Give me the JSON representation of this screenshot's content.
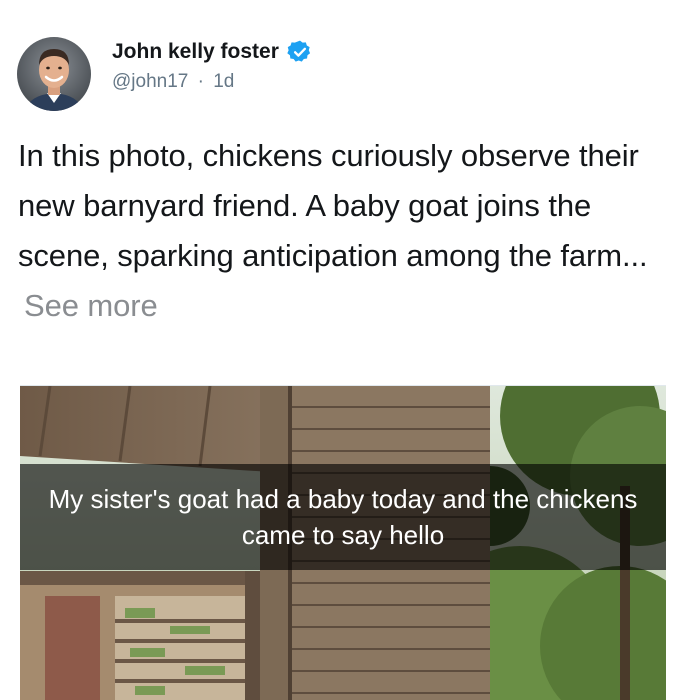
{
  "tweet": {
    "author": {
      "name": "John kelly foster",
      "handle": "@john17",
      "separator": "·",
      "time": "1d",
      "verified": true
    },
    "text": "In this photo, chickens curiously observe their new barnyard friend. A baby goat joins the scene, sparking anticipation among the farm...",
    "see_more_label": "See more",
    "media": {
      "caption": "My sister's goat had a baby today and the chickens came to say hello"
    }
  },
  "colors": {
    "name": "#14171a",
    "meta": "#657786",
    "verified_badge": "#1da1f2",
    "see_more": "#8a8d91"
  },
  "icons": {
    "verified": "verified-badge-icon"
  }
}
